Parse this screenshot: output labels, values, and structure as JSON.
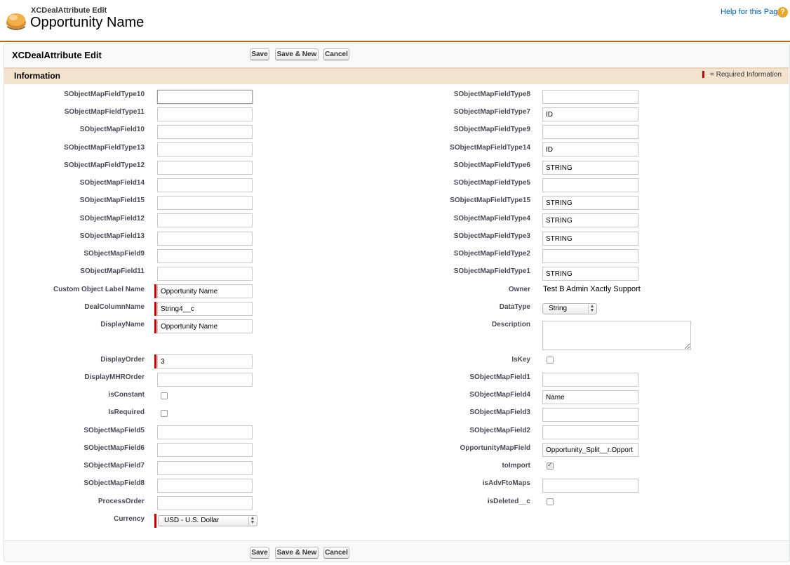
{
  "header": {
    "subtitle": "XCDealAttribute Edit",
    "title": "Opportunity Name",
    "help_label": "Help for this Page",
    "help_icon_glyph": "?"
  },
  "pageblock": {
    "title": "XCDealAttribute Edit",
    "save_label": "Save",
    "save_new_label": "Save & New",
    "cancel_label": "Cancel"
  },
  "section": {
    "title": "Information",
    "required_legend": "= Required Information"
  },
  "left_fields": [
    {
      "label": "SObjectMapFieldType10",
      "value": ""
    },
    {
      "label": "SObjectMapFieldType11",
      "value": ""
    },
    {
      "label": "SObjectMapField10",
      "value": ""
    },
    {
      "label": "SObjectMapFieldType13",
      "value": ""
    },
    {
      "label": "SObjectMapFieldType12",
      "value": ""
    },
    {
      "label": "SObjectMapField14",
      "value": ""
    },
    {
      "label": "SObjectMapField15",
      "value": ""
    },
    {
      "label": "SObjectMapField12",
      "value": ""
    },
    {
      "label": "SObjectMapField13",
      "value": ""
    },
    {
      "label": "SObjectMapField9",
      "value": ""
    },
    {
      "label": "SObjectMapField11",
      "value": ""
    },
    {
      "label": "Custom Object Label Name",
      "value": "Opportunity Name",
      "required": true
    },
    {
      "label": "DealColumnName",
      "value": "String4__c",
      "required": true
    },
    {
      "label": "DisplayName",
      "value": "Opportunity Name",
      "required": true
    },
    {
      "label": "DisplayOrder",
      "value": "3",
      "required": true
    },
    {
      "label": "DisplayMHROrder",
      "value": ""
    },
    {
      "label": "isConstant",
      "checked": false
    },
    {
      "label": "IsRequired",
      "checked": false
    },
    {
      "label": "SObjectMapField5",
      "value": ""
    },
    {
      "label": "SObjectMapField6",
      "value": ""
    },
    {
      "label": "SObjectMapField7",
      "value": ""
    },
    {
      "label": "SObjectMapField8",
      "value": ""
    },
    {
      "label": "ProcessOrder",
      "value": ""
    },
    {
      "label": "Currency",
      "value": "USD - U.S. Dollar",
      "required": true
    }
  ],
  "right_fields": [
    {
      "label": "SObjectMapFieldType8",
      "value": ""
    },
    {
      "label": "SObjectMapFieldType7",
      "value": "ID"
    },
    {
      "label": "SObjectMapFieldType9",
      "value": ""
    },
    {
      "label": "SObjectMapFieldType14",
      "value": "ID"
    },
    {
      "label": "SObjectMapFieldType6",
      "value": "STRING"
    },
    {
      "label": "SObjectMapFieldType5",
      "value": ""
    },
    {
      "label": "SObjectMapFieldType15",
      "value": "STRING"
    },
    {
      "label": "SObjectMapFieldType4",
      "value": "STRING"
    },
    {
      "label": "SObjectMapFieldType3",
      "value": "STRING"
    },
    {
      "label": "SObjectMapFieldType2",
      "value": ""
    },
    {
      "label": "SObjectMapFieldType1",
      "value": "STRING"
    },
    {
      "label": "Owner",
      "value": "Test B Admin Xactly Support"
    },
    {
      "label": "DataType",
      "value": "String"
    },
    {
      "label": "Description",
      "value": ""
    },
    {
      "label": "IsKey",
      "checked": false
    },
    {
      "label": "SObjectMapField1",
      "value": ""
    },
    {
      "label": "SObjectMapField4",
      "value": "Name"
    },
    {
      "label": "SObjectMapField3",
      "value": ""
    },
    {
      "label": "SObjectMapField2",
      "value": ""
    },
    {
      "label": "OpportunityMapField",
      "value": "Opportunity_Split__r.Opport"
    },
    {
      "label": "toImport",
      "checked": true
    },
    {
      "label": "isAdvFtoMaps",
      "value": ""
    },
    {
      "label": "isDeleted__c",
      "checked": false
    }
  ],
  "colors": {
    "required": "#cc0000",
    "section_bg": "#f3e2ce",
    "header_rule": "#a56c1c",
    "link": "#015ba7"
  }
}
